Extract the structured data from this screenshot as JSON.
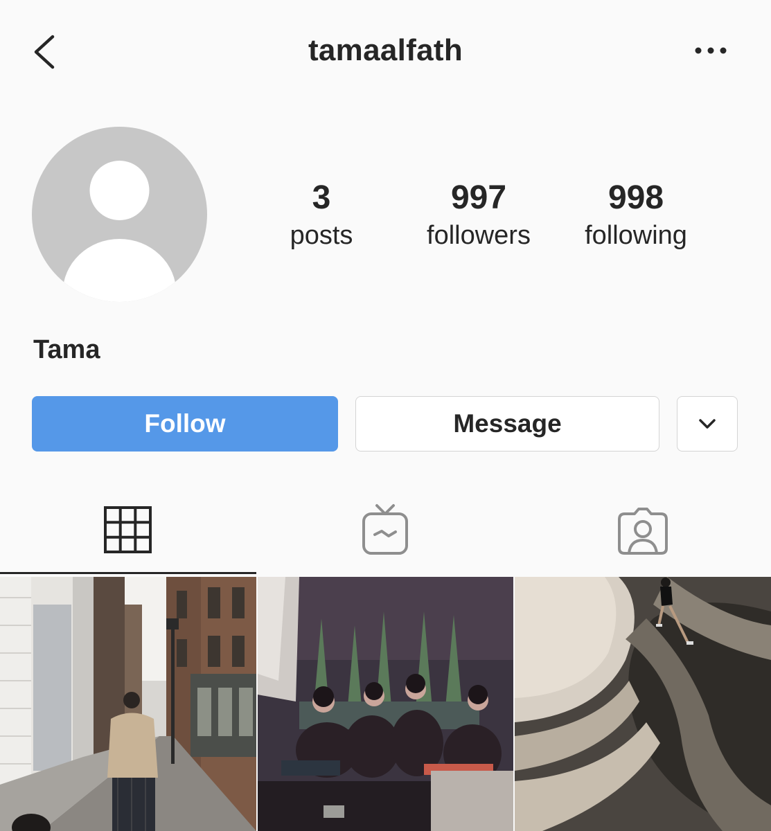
{
  "header": {
    "username": "tamaalfath",
    "back_icon": "chevron-left-icon",
    "more_icon": "more-horizontal-icon"
  },
  "profile": {
    "avatar_icon": "default-avatar-icon",
    "full_name": "Tama",
    "stats": {
      "posts": {
        "count": "3",
        "label": "posts"
      },
      "followers": {
        "count": "997",
        "label": "followers"
      },
      "following": {
        "count": "998",
        "label": "following"
      }
    }
  },
  "actions": {
    "follow_label": "Follow",
    "message_label": "Message",
    "dropdown_icon": "chevron-down-icon"
  },
  "tabs": [
    {
      "name": "posts-grid",
      "icon": "grid-icon",
      "active": true
    },
    {
      "name": "igtv",
      "icon": "igtv-icon",
      "active": false
    },
    {
      "name": "tagged",
      "icon": "tagged-user-icon",
      "active": false
    }
  ],
  "posts": [
    {
      "description_icon": "photo-street-man"
    },
    {
      "description_icon": "photo-group-night"
    },
    {
      "description_icon": "photo-runner-ramp"
    }
  ],
  "colors": {
    "background": "#fafafa",
    "follow_button": "#5598e8",
    "text": "#262626",
    "avatar_grey": "#c7c7c7"
  }
}
